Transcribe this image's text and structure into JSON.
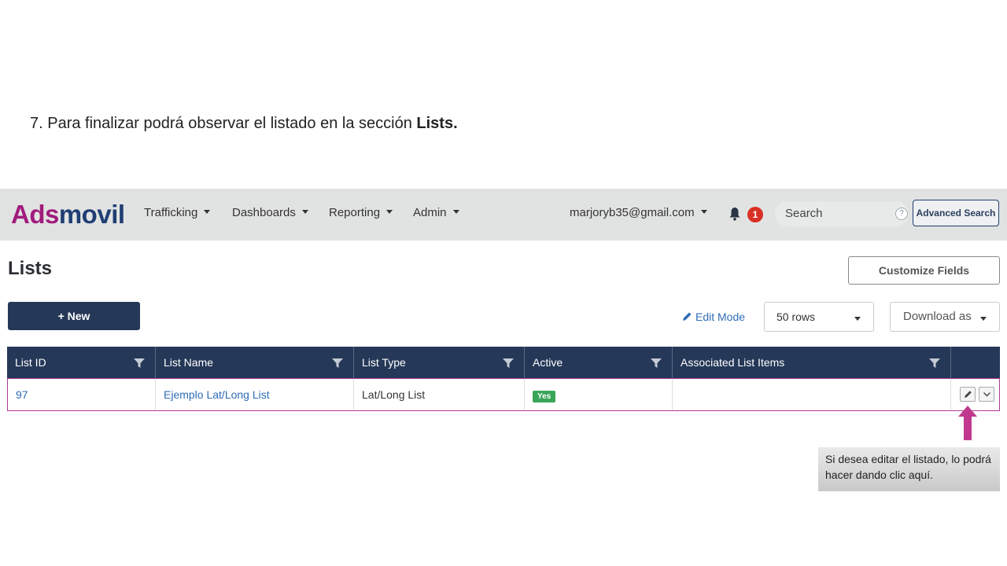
{
  "instruction": {
    "text": "7. Para finalizar podrá observar el listado en la sección ",
    "bold": "Lists."
  },
  "header": {
    "logo_part1": "Ads",
    "logo_part2": "movil",
    "nav": [
      "Trafficking",
      "Dashboards",
      "Reporting",
      "Admin"
    ],
    "user_email": "marjoryb35@gmail.com",
    "notification_count": "1",
    "search_placeholder": "Search",
    "help_icon": "?",
    "advanced_search_label": "Advanced Search"
  },
  "page": {
    "title": "Lists",
    "customize_label": "Customize Fields",
    "new_label": "+ New",
    "edit_mode_label": "Edit Mode",
    "rows_value": "50 rows",
    "download_label": "Download as"
  },
  "table": {
    "columns": [
      "List ID",
      "List Name",
      "List Type",
      "Active",
      "Associated List Items"
    ],
    "rows": [
      {
        "id": "97",
        "name": "Ejemplo Lat/Long List",
        "type": "Lat/Long List",
        "active": "Yes",
        "associated": ""
      }
    ]
  },
  "annotation": {
    "note": "Si desea editar el listado, lo podrá hacer dando clic aquí."
  },
  "colors": {
    "brand_magenta": "#a01c7d",
    "brand_navy": "#1f3e73",
    "header_bg": "#253858",
    "active_green": "#3aa55a",
    "arrow": "#c0398e"
  }
}
